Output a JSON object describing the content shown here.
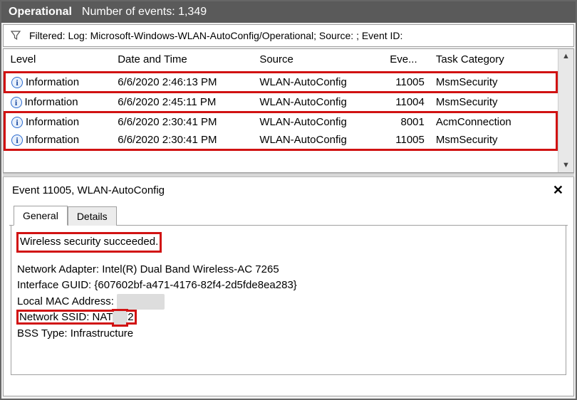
{
  "titlebar": {
    "title": "Operational",
    "events_label": "Number of events: 1,349"
  },
  "filter": {
    "text": "Filtered: Log: Microsoft-Windows-WLAN-AutoConfig/Operational; Source: ; Event ID:"
  },
  "columns": {
    "level": "Level",
    "date": "Date and Time",
    "source": "Source",
    "eveid": "Eve...",
    "task": "Task Category"
  },
  "rows": [
    {
      "level": "Information",
      "date": "6/6/2020 2:46:13 PM",
      "source": "WLAN-AutoConfig",
      "eveid": "11005",
      "task": "MsmSecurity",
      "highlight": true
    },
    {
      "level": "Information",
      "date": "6/6/2020 2:45:11 PM",
      "source": "WLAN-AutoConfig",
      "eveid": "11004",
      "task": "MsmSecurity",
      "highlight": false
    },
    {
      "level": "Information",
      "date": "6/6/2020 2:30:41 PM",
      "source": "WLAN-AutoConfig",
      "eveid": "8001",
      "task": "AcmConnection",
      "highlight": true
    },
    {
      "level": "Information",
      "date": "6/6/2020 2:30:41 PM",
      "source": "WLAN-AutoConfig",
      "eveid": "11005",
      "task": "MsmSecurity",
      "highlight": true
    }
  ],
  "detail": {
    "header": "Event 11005, WLAN-AutoConfig",
    "tabs": {
      "general": "General",
      "details": "Details"
    },
    "summary": "Wireless security succeeded.",
    "adapter_label": "Network Adapter: ",
    "adapter_value": "Intel(R) Dual Band Wireless-AC 7265",
    "guid_label": "Interface GUID: ",
    "guid_value": "{607602bf-a471-4176-82f4-2d5fde8ea283}",
    "mac_label": "Local MAC Address:",
    "ssid_label": "Network SSID: ",
    "ssid_value_prefix": "NAT",
    "ssid_value_suffix": "2",
    "bss_label": "BSS Type: ",
    "bss_value": "Infrastructure"
  }
}
